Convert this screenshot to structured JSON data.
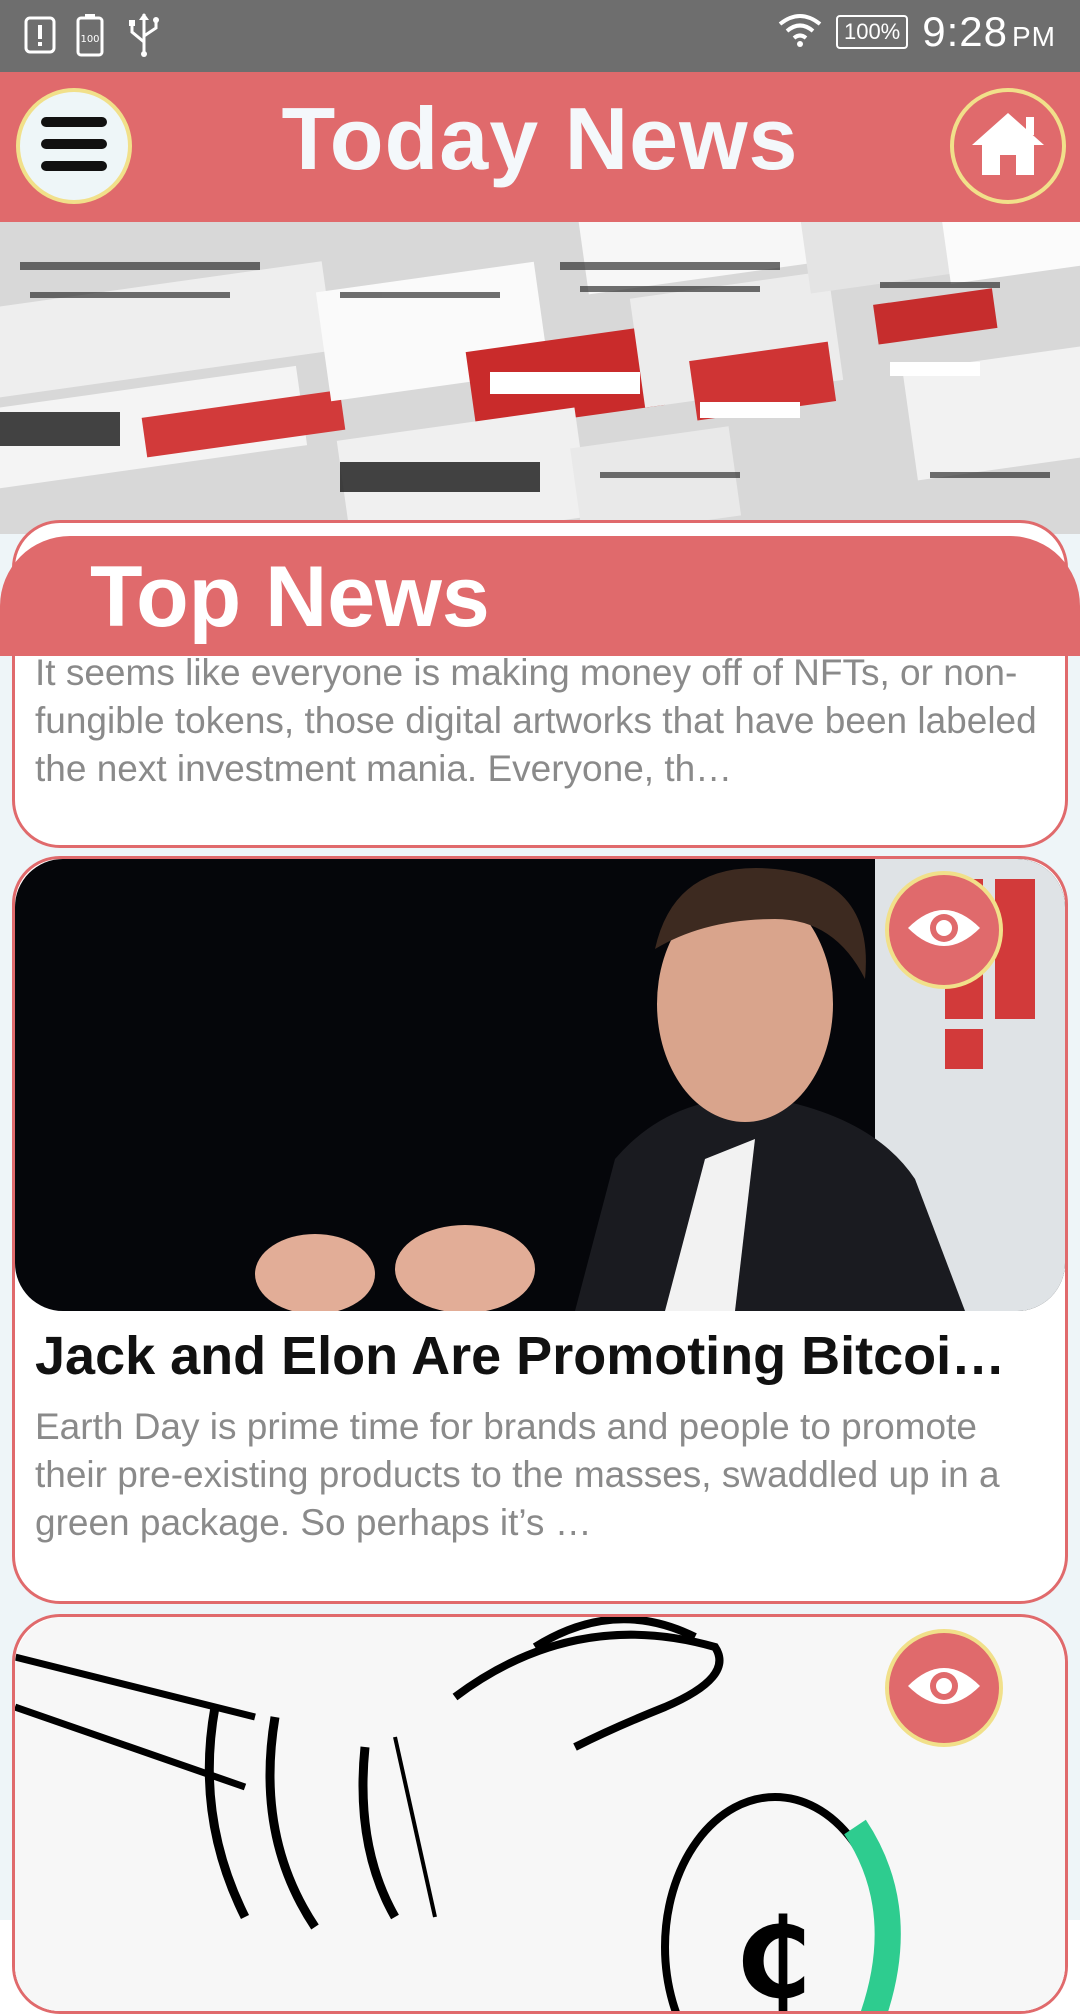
{
  "status_bar": {
    "time": "9:28",
    "ampm": "PM",
    "battery": "100%",
    "icons": [
      "alert-icon",
      "battery-saver-icon",
      "usb-icon",
      "wifi-icon",
      "battery-icon"
    ]
  },
  "app_bar": {
    "title": "Today News",
    "menu_icon": "hamburger-menu-icon",
    "home_icon": "home-icon"
  },
  "section": {
    "title": "Top News"
  },
  "articles": [
    {
      "title": "",
      "description": "It seems like everyone is making money off of NFTs, or non-fungible tokens, those digital artworks that have been labeled the next investment mania. Everyone, th…"
    },
    {
      "title": "Jack and Elon Are Promoting Bitcoi…",
      "description": "Earth Day is prime time for brands and people to promote their pre-existing products to the masses, swaddled up in a green package. So perhaps it’s …",
      "image": "photo-man-in-suit"
    },
    {
      "title": "",
      "description": "",
      "image": "illustration-hand-holding-bitcoin"
    }
  ],
  "colors": {
    "accent": "#e06a6c",
    "ring": "#f1e08a",
    "status_bar": "#6e6e6e",
    "list_bg": "#eef5f8"
  }
}
